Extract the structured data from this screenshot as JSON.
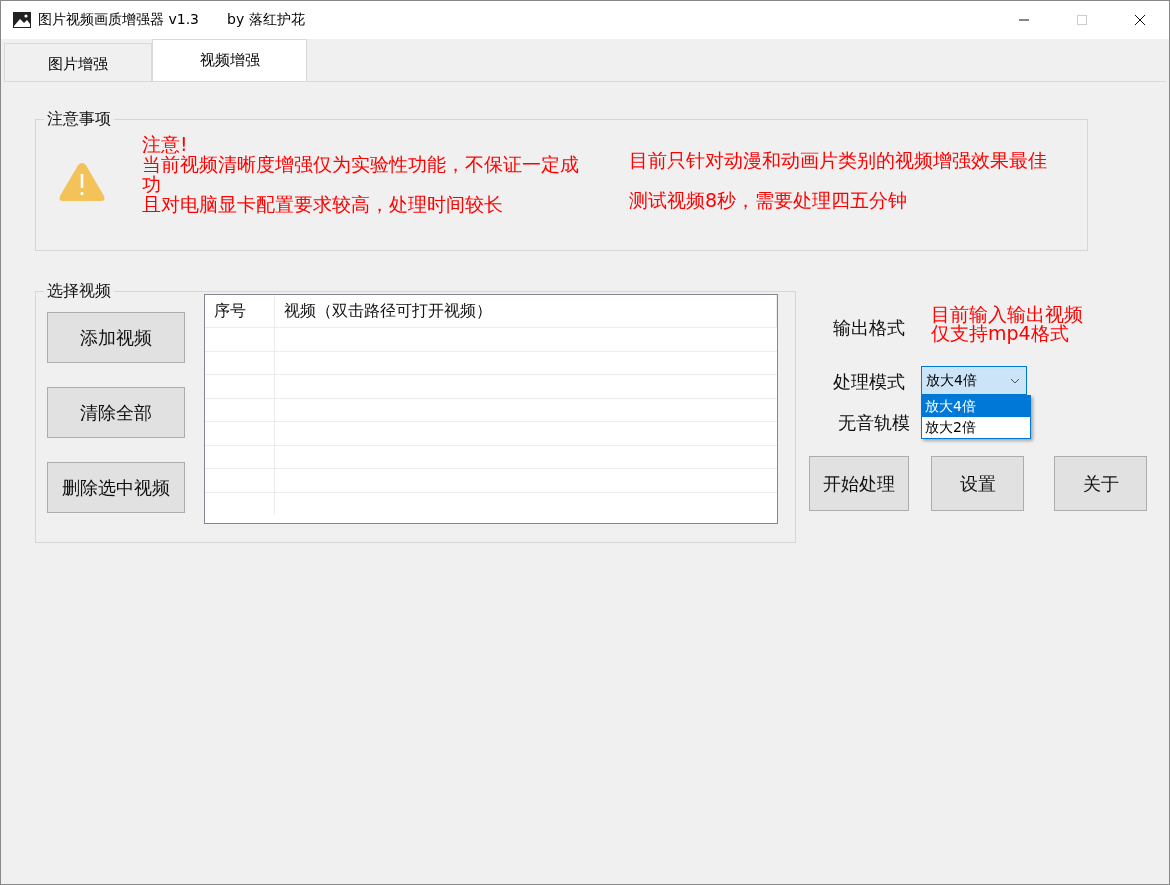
{
  "window": {
    "title": "图片视频画质增强器 v1.3",
    "author": "by 落红护花",
    "maximize_disabled": true
  },
  "tabs": [
    {
      "label": "图片增强",
      "selected": false
    },
    {
      "label": "视频增强",
      "selected": true
    }
  ],
  "notice": {
    "title": "注意事项",
    "left_lines": [
      "注意!",
      "当前视频清晰度增强仅为实验性功能，不保证一定成功",
      "且对电脑显卡配置要求较高，处理时间较长"
    ],
    "right_lines": [
      "目前只针对动漫和动画片类别的视频增强效果最佳",
      "测试视频8秒，需要处理四五分钟"
    ]
  },
  "video_group": {
    "title": "选择视频",
    "buttons": [
      "添加视频",
      "清除全部",
      "删除选中视频"
    ],
    "table": {
      "columns": [
        "序号",
        "视频（双击路径可打开视频）"
      ]
    }
  },
  "settings": {
    "output_format_label": "输出格式",
    "format_note": [
      "目前输入输出视频",
      "仅支持mp4格式"
    ],
    "mode_label": "处理模式",
    "mode_value": "放大4倍",
    "mode_expanded": true,
    "mode_options": [
      {
        "label": "放大4倍",
        "selected": true
      },
      {
        "label": "放大2倍",
        "selected": false
      }
    ],
    "mute_label": "无音轨模"
  },
  "actions": [
    "开始处理",
    "设置",
    "关于"
  ]
}
